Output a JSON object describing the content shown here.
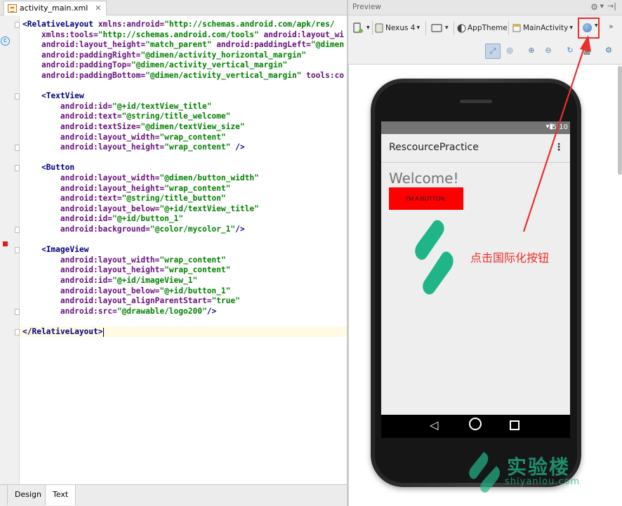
{
  "editor": {
    "tab_label": "activity_main.xml",
    "code_lines": [
      [
        [
          "tag",
          "<RelativeLayout "
        ],
        [
          "attr",
          "xmlns:android="
        ],
        [
          "val",
          "\"http://schemas.android.com/apk/res/"
        ]
      ],
      [
        [
          "pl",
          "    "
        ],
        [
          "attr",
          "xmlns:tools="
        ],
        [
          "val",
          "\"http://schemas.android.com/tools\" "
        ],
        [
          "attr",
          "android:layout_wi"
        ]
      ],
      [
        [
          "pl",
          "    "
        ],
        [
          "attr",
          "android:layout_height="
        ],
        [
          "val",
          "\"match_parent\" "
        ],
        [
          "attr",
          "android:paddingLeft="
        ],
        [
          "val",
          "\"@dimen"
        ]
      ],
      [
        [
          "pl",
          "    "
        ],
        [
          "attr",
          "android:paddingRight="
        ],
        [
          "val",
          "\"@dimen/activity_horizontal_margin\""
        ]
      ],
      [
        [
          "pl",
          "    "
        ],
        [
          "attr",
          "android:paddingTop="
        ],
        [
          "val",
          "\"@dimen/activity_vertical_margin\""
        ]
      ],
      [
        [
          "pl",
          "    "
        ],
        [
          "attr",
          "android:paddingBottom="
        ],
        [
          "val",
          "\"@dimen/activity_vertical_margin\" "
        ],
        [
          "attr",
          "tools:co"
        ]
      ],
      [],
      [
        [
          "pl",
          "    "
        ],
        [
          "tag",
          "<TextView"
        ]
      ],
      [
        [
          "pl",
          "        "
        ],
        [
          "attr",
          "android:id="
        ],
        [
          "val",
          "\"@+id/textView_title\""
        ]
      ],
      [
        [
          "pl",
          "        "
        ],
        [
          "attr",
          "android:text="
        ],
        [
          "val",
          "\"@string/title_welcome\""
        ]
      ],
      [
        [
          "pl",
          "        "
        ],
        [
          "attr",
          "android:textSize="
        ],
        [
          "val",
          "\"@dimen/textView_size\""
        ]
      ],
      [
        [
          "pl",
          "        "
        ],
        [
          "attr",
          "android:layout_width="
        ],
        [
          "val",
          "\"wrap_content\""
        ]
      ],
      [
        [
          "pl",
          "        "
        ],
        [
          "attr",
          "android:layout_height="
        ],
        [
          "val",
          "\"wrap_content\" "
        ],
        [
          "tag",
          "/>"
        ]
      ],
      [],
      [
        [
          "pl",
          "    "
        ],
        [
          "tag",
          "<Button"
        ]
      ],
      [
        [
          "pl",
          "        "
        ],
        [
          "attr",
          "android:layout_width="
        ],
        [
          "val",
          "\"@dimen/button_width\""
        ]
      ],
      [
        [
          "pl",
          "        "
        ],
        [
          "attr",
          "android:layout_height="
        ],
        [
          "val",
          "\"wrap_content\""
        ]
      ],
      [
        [
          "pl",
          "        "
        ],
        [
          "attr",
          "android:text="
        ],
        [
          "val",
          "\"@string/title_button\""
        ]
      ],
      [
        [
          "pl",
          "        "
        ],
        [
          "attr",
          "android:layout_below="
        ],
        [
          "val",
          "\"@+id/textView_title\""
        ]
      ],
      [
        [
          "pl",
          "        "
        ],
        [
          "attr",
          "android:id="
        ],
        [
          "val",
          "\"@+id/button_1\""
        ]
      ],
      [
        [
          "pl",
          "        "
        ],
        [
          "attr",
          "android:background="
        ],
        [
          "val",
          "\"@color/mycolor_1\""
        ],
        [
          "tag",
          "/>"
        ]
      ],
      [],
      [
        [
          "pl",
          "    "
        ],
        [
          "tag",
          "<ImageView"
        ]
      ],
      [
        [
          "pl",
          "        "
        ],
        [
          "attr",
          "android:layout_width="
        ],
        [
          "val",
          "\"wrap_content\""
        ]
      ],
      [
        [
          "pl",
          "        "
        ],
        [
          "attr",
          "android:layout_height="
        ],
        [
          "val",
          "\"wrap_content\""
        ]
      ],
      [
        [
          "pl",
          "        "
        ],
        [
          "attr",
          "android:id="
        ],
        [
          "val",
          "\"@+id/imageView_1\""
        ]
      ],
      [
        [
          "pl",
          "        "
        ],
        [
          "attr",
          "android:layout_below="
        ],
        [
          "val",
          "\"@+id/button_1\""
        ]
      ],
      [
        [
          "pl",
          "        "
        ],
        [
          "attr",
          "android:layout_alignParentStart="
        ],
        [
          "val",
          "\"true\""
        ]
      ],
      [
        [
          "pl",
          "        "
        ],
        [
          "attr",
          "android:src="
        ],
        [
          "val",
          "\"@drawable/logo200\""
        ],
        [
          "tag",
          "/>"
        ]
      ],
      [],
      [
        [
          "tag",
          "</RelativeLayout>"
        ]
      ]
    ]
  },
  "bottom_tabs": {
    "design": "Design",
    "text": "Text"
  },
  "preview": {
    "title": "Preview",
    "toolbar": {
      "device": "Nexus 4",
      "theme": "AppTheme",
      "activity": "MainActivity"
    },
    "phone": {
      "status_time": "5:10",
      "app_title": "RescourcePractice",
      "welcome": "Welcome!",
      "button_text": "I'M A BUTTON."
    }
  },
  "annotation": {
    "text": "点击国际化按钮",
    "color": "#e8302c"
  },
  "watermark": {
    "title": "实验楼",
    "url": "shiyanlou.com"
  },
  "colors": {
    "tag": "#000080",
    "attr": "#660e7a",
    "value": "#008000",
    "button_bg": "#ff0000",
    "logo": "#1fb589"
  }
}
